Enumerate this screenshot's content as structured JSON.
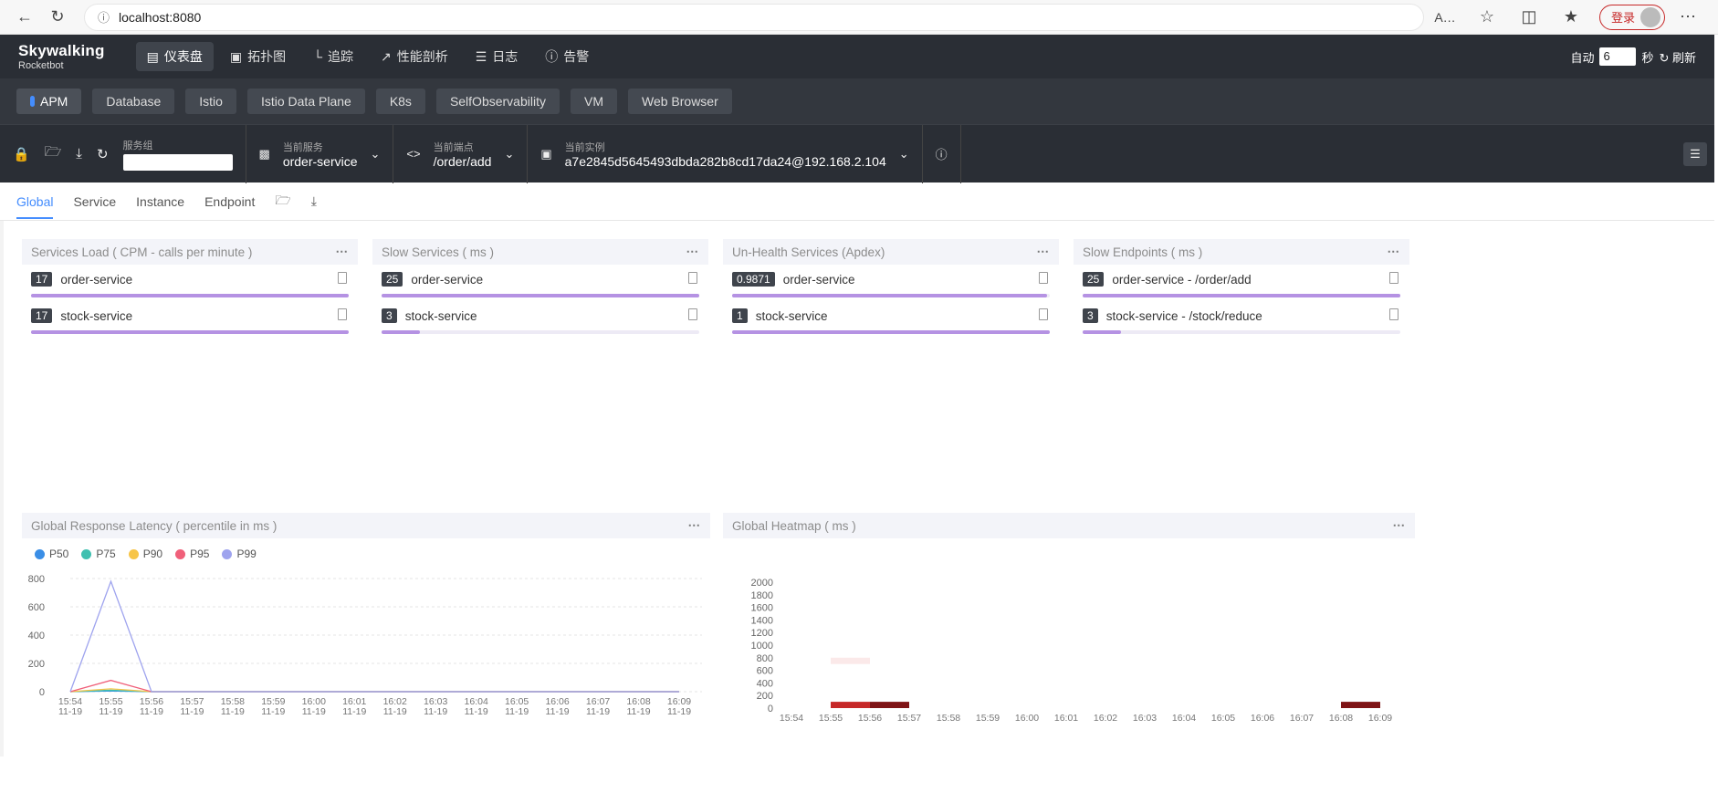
{
  "browser": {
    "url": "localhost:8080",
    "login": "登录"
  },
  "nav": {
    "logo": "Skywalking",
    "logo_sub": "Rocketbot",
    "items": [
      {
        "label": "仪表盘",
        "icon": "dashboard-icon",
        "active": true
      },
      {
        "label": "拓扑图",
        "icon": "topology-icon"
      },
      {
        "label": "追踪",
        "icon": "trace-icon"
      },
      {
        "label": "性能剖析",
        "icon": "profile-icon"
      },
      {
        "label": "日志",
        "icon": "log-icon"
      },
      {
        "label": "告警",
        "icon": "alarm-icon"
      }
    ],
    "auto_label": "自动",
    "auto_value": "6",
    "seconds": "秒",
    "refresh": "刷新"
  },
  "layers": [
    "APM",
    "Database",
    "Istio",
    "Istio Data Plane",
    "K8s",
    "SelfObservability",
    "VM",
    "Web Browser"
  ],
  "selectors": {
    "group_label": "服务组",
    "service_label": "当前服务",
    "service_value": "order-service",
    "endpoint_label": "当前端点",
    "endpoint_value": "/order/add",
    "instance_label": "当前实例",
    "instance_value": "a7e2845d5645493dbda282b8cd17da24@192.168.2.104"
  },
  "tabs": [
    "Global",
    "Service",
    "Instance",
    "Endpoint"
  ],
  "panels": [
    {
      "title": "Services Load ( CPM - calls per minute )",
      "items": [
        {
          "value": "17",
          "name": "order-service",
          "ratio": 1.0
        },
        {
          "value": "17",
          "name": "stock-service",
          "ratio": 1.0
        }
      ]
    },
    {
      "title": "Slow Services ( ms )",
      "items": [
        {
          "value": "25",
          "name": "order-service",
          "ratio": 1.0
        },
        {
          "value": "3",
          "name": "stock-service",
          "ratio": 0.12
        }
      ]
    },
    {
      "title": "Un-Health Services (Apdex)",
      "items": [
        {
          "value": "0.9871",
          "name": "order-service",
          "ratio": 0.99
        },
        {
          "value": "1",
          "name": "stock-service",
          "ratio": 1.0
        }
      ]
    },
    {
      "title": "Slow Endpoints ( ms )",
      "items": [
        {
          "value": "25",
          "name": "order-service - /order/add",
          "ratio": 1.0
        },
        {
          "value": "3",
          "name": "stock-service - /stock/reduce",
          "ratio": 0.12
        }
      ]
    }
  ],
  "latency": {
    "title": "Global Response Latency ( percentile in ms )",
    "chart_data": {
      "type": "line",
      "categories": [
        "15:54\n11-19",
        "15:55\n11-19",
        "15:56\n11-19",
        "15:57\n11-19",
        "15:58\n11-19",
        "15:59\n11-19",
        "16:00\n11-19",
        "16:01\n11-19",
        "16:02\n11-19",
        "16:03\n11-19",
        "16:04\n11-19",
        "16:05\n11-19",
        "16:06\n11-19",
        "16:07\n11-19",
        "16:08\n11-19",
        "16:09\n11-19"
      ],
      "yticks": [
        0,
        200,
        400,
        600,
        800
      ],
      "ylim": [
        0,
        800
      ],
      "series": [
        {
          "name": "P50",
          "color": "#3a8ee6",
          "values": [
            0,
            5,
            0,
            0,
            0,
            0,
            0,
            0,
            0,
            0,
            0,
            0,
            0,
            0,
            0,
            0
          ]
        },
        {
          "name": "P75",
          "color": "#40c0b0",
          "values": [
            0,
            10,
            0,
            0,
            0,
            0,
            0,
            0,
            0,
            0,
            0,
            0,
            0,
            0,
            0,
            0
          ]
        },
        {
          "name": "P90",
          "color": "#f7c548",
          "values": [
            0,
            20,
            0,
            0,
            0,
            0,
            0,
            0,
            0,
            0,
            0,
            0,
            0,
            0,
            0,
            0
          ]
        },
        {
          "name": "P95",
          "color": "#f0607a",
          "values": [
            0,
            80,
            0,
            0,
            0,
            0,
            0,
            0,
            0,
            0,
            0,
            0,
            0,
            0,
            0,
            0
          ]
        },
        {
          "name": "P99",
          "color": "#9ea3ee",
          "values": [
            0,
            780,
            0,
            0,
            0,
            0,
            0,
            0,
            0,
            0,
            0,
            0,
            0,
            0,
            0,
            0
          ]
        }
      ]
    }
  },
  "heatmap": {
    "title": "Global Heatmap ( ms )",
    "chart_data": {
      "type": "heatmap",
      "categories": [
        "15:54\n11-19",
        "15:55\n11-19",
        "15:56\n11-19",
        "15:57\n11-19",
        "15:58\n11-19",
        "15:59\n11-19",
        "16:00\n11-19",
        "16:01\n11-19",
        "16:02\n11-19",
        "16:03\n11-19",
        "16:04\n11-19",
        "16:05\n11-19",
        "16:06\n11-19",
        "16:07\n11-19",
        "16:08\n11-19",
        "16:09\n11-19"
      ],
      "yticks": [
        0,
        200,
        400,
        600,
        800,
        1000,
        1200,
        1400,
        1600,
        1800,
        2000
      ],
      "cells": [
        {
          "x": 1,
          "y": 0,
          "level": 0.7,
          "color": "#c62828"
        },
        {
          "x": 2,
          "y": 0,
          "level": 1.0,
          "color": "#7f1416"
        },
        {
          "x": 1,
          "y": 700,
          "level": 0.05,
          "color": "#fbe9e9"
        },
        {
          "x": 14,
          "y": 0,
          "level": 1.0,
          "color": "#7f1416"
        }
      ]
    }
  }
}
